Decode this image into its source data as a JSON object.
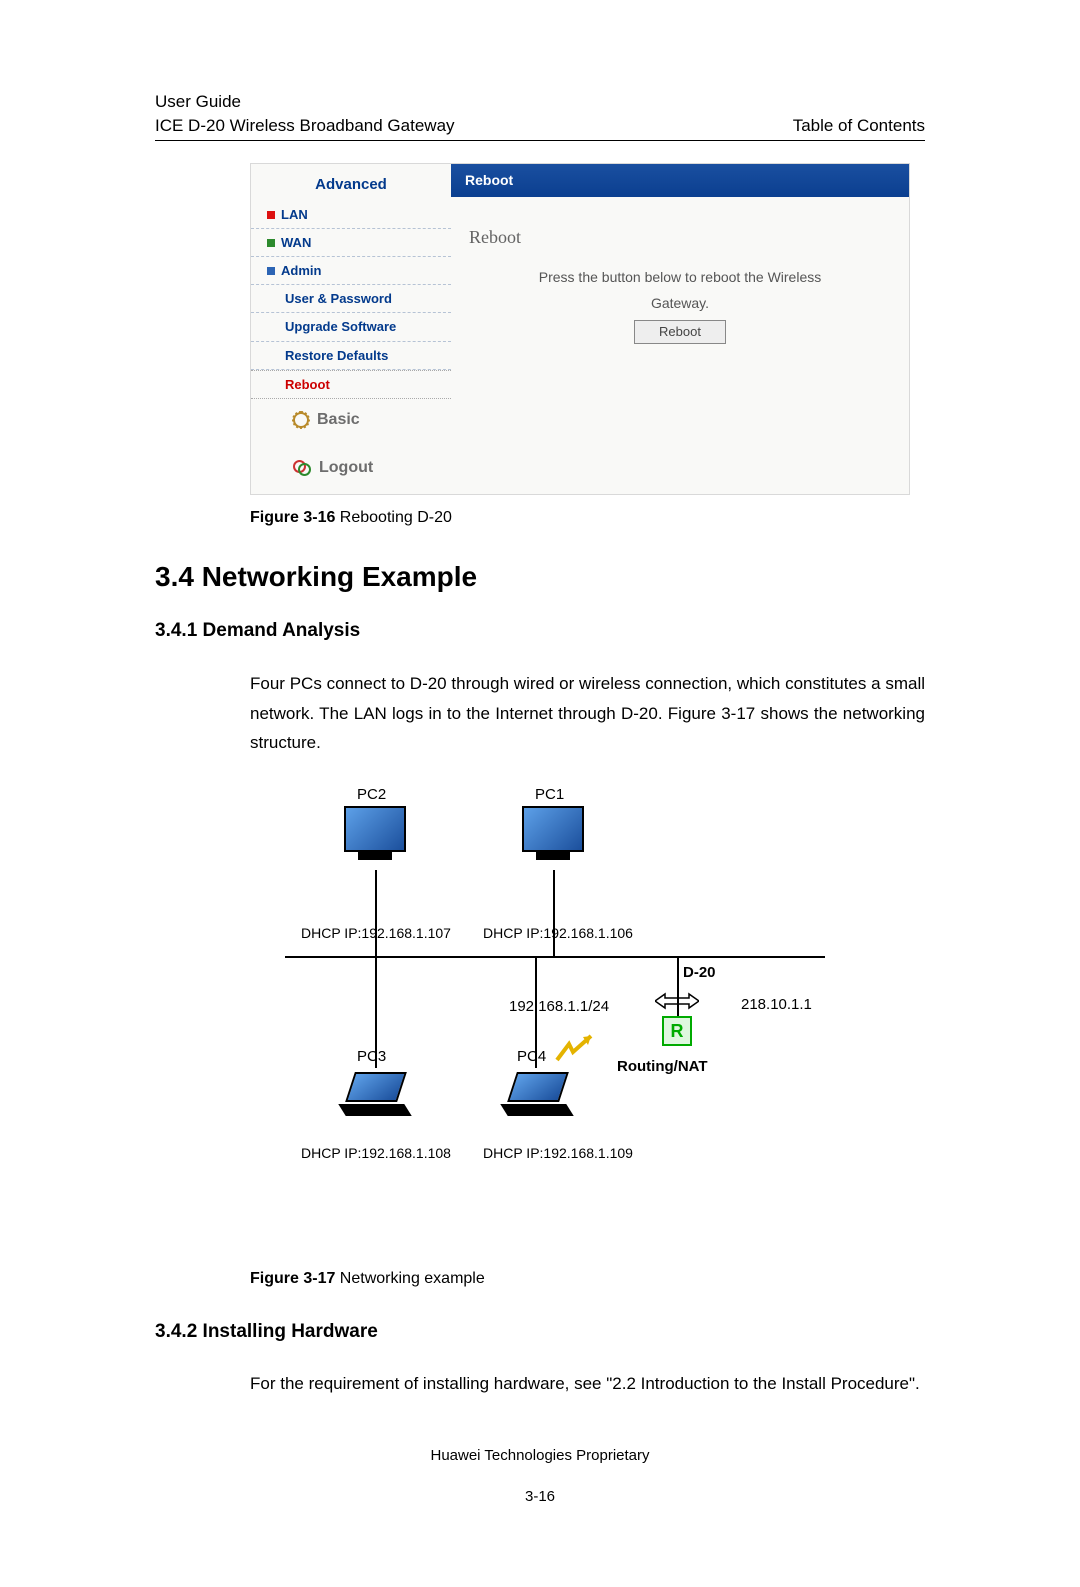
{
  "header": {
    "guide": "User Guide",
    "device": "ICE D-20 Wireless Broadband Gateway",
    "toc": "Table of Contents"
  },
  "ui": {
    "sidebar": {
      "title": "Advanced",
      "lan": "LAN",
      "wan": "WAN",
      "admin": "Admin",
      "user_pw": "User & Password",
      "upgrade": "Upgrade Software",
      "restore": "Restore Defaults",
      "reboot": "Reboot",
      "basic": "Basic",
      "logout": "Logout"
    },
    "bar": "Reboot",
    "main_h": "Reboot",
    "main_desc1": "Press the button below to reboot the Wireless",
    "main_desc2": "Gateway.",
    "btn": "Reboot"
  },
  "fig16": {
    "label": "Figure 3-16",
    "text": " Rebooting D-20"
  },
  "section": {
    "h2": "3.4  Networking Example",
    "h341": "3.4.1  Demand Analysis",
    "p1": "Four PCs connect to D-20 through wired or wireless connection, which constitutes a small network. The LAN logs in to the Internet through D-20. Figure 3-17 shows the networking structure.",
    "h342": "3.4.2  Installing Hardware",
    "p2": "For the requirement of installing hardware, see \"2.2   Introduction to the Install Procedure\"."
  },
  "diagram": {
    "pc1": "PC1",
    "pc2": "PC2",
    "pc3": "PC3",
    "pc4": "PC4",
    "ip1": "DHCP IP:192.168.1.106",
    "ip2": "DHCP IP:192.168.1.107",
    "ip3": "DHCP IP:192.168.1.108",
    "ip4": "DHCP IP:192.168.1.109",
    "d20": "D-20",
    "gw": "192.168.1.1/24",
    "wan": "218.10.1.1",
    "route": "Routing/NAT",
    "R": "R"
  },
  "fig17": {
    "label": "Figure 3-17",
    "text": " Networking example"
  },
  "footer": "Huawei Technologies Proprietary",
  "page": "3-16"
}
